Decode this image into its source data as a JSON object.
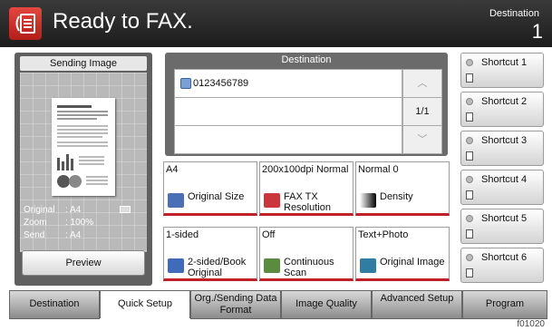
{
  "header": {
    "title": "Ready to FAX.",
    "destination_label": "Destination",
    "destination_count": "1"
  },
  "left_panel": {
    "title": "Sending Image",
    "info": [
      {
        "key": "Original",
        "value": ": A4"
      },
      {
        "key": "Zoom",
        "value": ": 100%"
      },
      {
        "key": "Send",
        "value": ": A4"
      }
    ],
    "preview_label": "Preview"
  },
  "destination_panel": {
    "title": "Destination",
    "entries": [
      "0123456789",
      "",
      ""
    ],
    "page_indicator": "1/1"
  },
  "functions": [
    {
      "value": "A4",
      "name": "Original Size",
      "icon": "original-size-icon"
    },
    {
      "value": "200x100dpi Normal",
      "name": "FAX TX Resolution",
      "icon": "fax-resolution-icon"
    },
    {
      "value": "Normal 0",
      "name": "Density",
      "icon": "density-icon"
    },
    {
      "value": "1-sided",
      "name": "2-sided/Book Original",
      "icon": "two-sided-icon"
    },
    {
      "value": "Off",
      "name": "Continuous Scan",
      "icon": "continuous-scan-icon"
    },
    {
      "value": "Text+Photo",
      "name": "Original Image",
      "icon": "original-image-icon"
    }
  ],
  "shortcuts": [
    "Shortcut 1",
    "Shortcut 2",
    "Shortcut 3",
    "Shortcut 4",
    "Shortcut 5",
    "Shortcut 6"
  ],
  "tabs": [
    "Destination",
    "Quick Setup",
    "Org./Sending Data Format",
    "Image Quality",
    "Advanced Setup",
    "Program"
  ],
  "active_tab": "Quick Setup",
  "figure_code": "f01020",
  "colors": {
    "accent": "#c0202a",
    "header": "#2a2a2a"
  }
}
